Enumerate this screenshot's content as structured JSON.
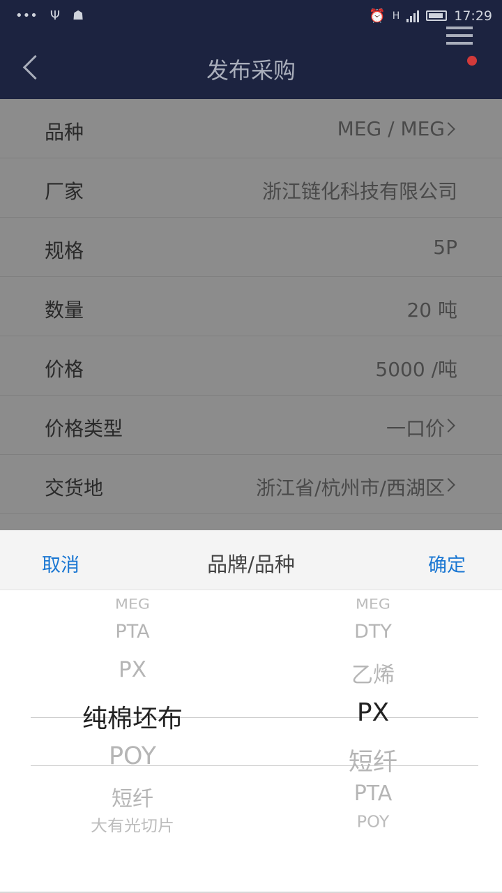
{
  "status_bar": {
    "time": "17:29",
    "dots": "•••",
    "usb": "Ψ",
    "bug": "☗",
    "alarm": "⏰",
    "net": "H"
  },
  "nav": {
    "title": "发布采购"
  },
  "form": {
    "rows": [
      {
        "label": "品种",
        "value": "MEG / MEG",
        "chevron": true
      },
      {
        "label": "厂家",
        "value": "浙江链化科技有限公司",
        "chevron": false
      },
      {
        "label": "规格",
        "value": "5P",
        "chevron": false
      },
      {
        "label": "数量",
        "value": "20 吨",
        "chevron": false
      },
      {
        "label": "价格",
        "value": "5000 /吨",
        "chevron": false
      },
      {
        "label": "价格类型",
        "value": "一口价",
        "chevron": true
      },
      {
        "label": "交货地",
        "value": "浙江省/杭州市/西湖区",
        "chevron": true
      }
    ]
  },
  "picker": {
    "cancel": "取消",
    "title": "品牌/品种",
    "confirm": "确定",
    "left_column": [
      "MEG",
      "PTA",
      "PX",
      "纯棉坯布",
      "POY",
      "短纤",
      "大有光切片"
    ],
    "left_selected": "纯棉坯布",
    "right_column": [
      "MEG",
      "DTY",
      "乙烯",
      "PX",
      "短纤",
      "PTA",
      "POY"
    ],
    "right_selected": "PX"
  }
}
